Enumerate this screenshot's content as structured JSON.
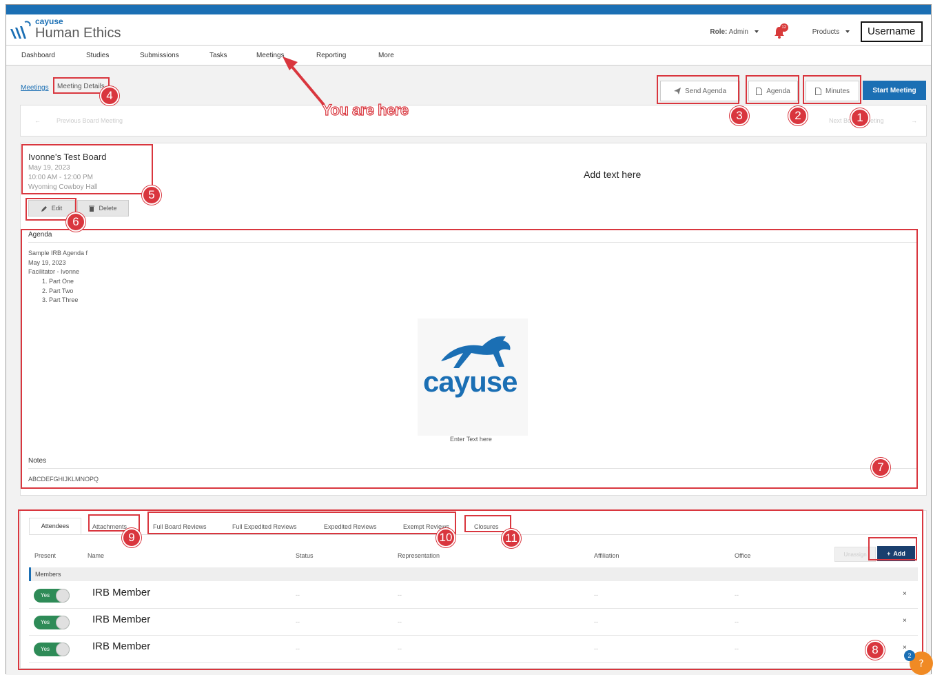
{
  "app": {
    "logo_small": "cayuse",
    "logo_name": "Human Ethics"
  },
  "header": {
    "role_label": "Role:",
    "role_value": "Admin",
    "notification_count": "12",
    "products_label": "Products",
    "username": "Username"
  },
  "nav": {
    "items": [
      "Dashboard",
      "Studies",
      "Submissions",
      "Tasks",
      "Meetings",
      "Reporting",
      "More"
    ]
  },
  "breadcrumb": {
    "parent": "Meetings",
    "current": "Meeting Details"
  },
  "actions": {
    "send_agenda": "Send Agenda",
    "agenda": "Agenda",
    "minutes": "Minutes",
    "start_meeting": "Start Meeting"
  },
  "pager": {
    "previous": "Previous Board Meeting",
    "next": "Next Board Meeting"
  },
  "meeting": {
    "title": "Ivonne's Test Board",
    "date": "May 19, 2023",
    "time": "10:00 AM - 12:00 PM",
    "location": "Wyoming Cowboy Hall",
    "side_text": "Add text here",
    "edit_label": "Edit",
    "delete_label": "Delete"
  },
  "agenda": {
    "title": "Agenda",
    "lines": [
      "Sample IRB Agenda f",
      "May 19, 2023",
      "Facilitator - Ivonne"
    ],
    "items": [
      "1. Part One",
      "2. Part Two",
      "3. Part Three"
    ],
    "logo_word": "cayuse",
    "enter_text": "Enter Text here"
  },
  "notes": {
    "title": "Notes",
    "text": "ABCDEFGHIJKLMNOPQ"
  },
  "tabs": [
    "Attendees",
    "Attachments",
    "Full Board Reviews",
    "Full Expedited Reviews",
    "Expedited Reviews",
    "Exempt Reviews",
    "Closures"
  ],
  "table": {
    "columns": [
      "Present",
      "Name",
      "Status",
      "Representation",
      "Affiliation",
      "Office"
    ],
    "disabled_button": "Unassign",
    "add_label": "Add",
    "group_label": "Members",
    "rows": [
      {
        "present": "Yes",
        "name": "IRB Member",
        "status": "--",
        "representation": "--",
        "affiliation": "--",
        "office": "--"
      },
      {
        "present": "Yes",
        "name": "IRB Member",
        "status": "--",
        "representation": "--",
        "affiliation": "--",
        "office": "--"
      },
      {
        "present": "Yes",
        "name": "IRB Member",
        "status": "--",
        "representation": "--",
        "affiliation": "--",
        "office": "--"
      }
    ]
  },
  "annotations": {
    "you_are_here": "You are here",
    "numbers": [
      "1",
      "2",
      "3",
      "4",
      "5",
      "6",
      "7",
      "8",
      "9",
      "10",
      "11"
    ]
  },
  "help": {
    "count": "2"
  },
  "colors": {
    "brand_blue": "#1b6fb4",
    "annotation_red": "#d9363e",
    "toggle_green": "#2e8b57",
    "add_navy": "#1a3f6e"
  }
}
